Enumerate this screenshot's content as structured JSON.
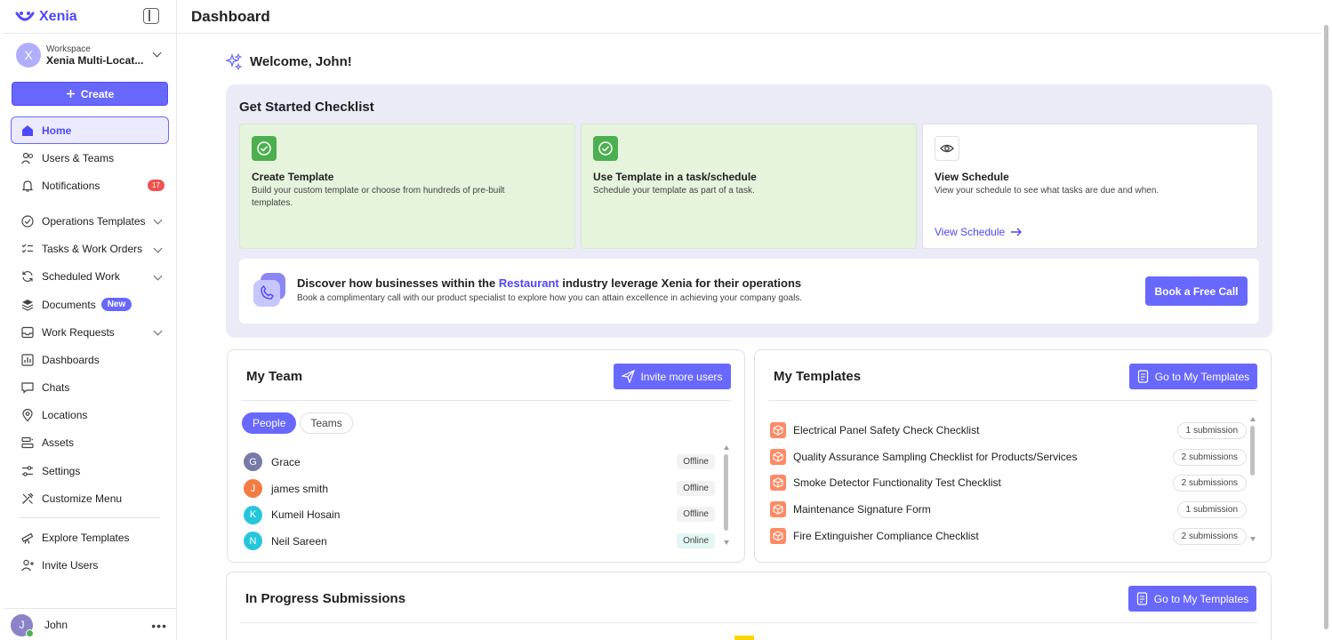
{
  "brand": {
    "name": "Xenia",
    "color": "#4E48FA"
  },
  "workspace": {
    "label": "Workspace",
    "name": "Xenia Multi-Locat...",
    "avatar_letter": "X"
  },
  "create_label": "Create",
  "nav": [
    {
      "label": "Home",
      "icon": "home-icon",
      "active": true
    },
    {
      "label": "Users & Teams",
      "icon": "users-icon"
    },
    {
      "label": "Notifications",
      "icon": "bell-icon",
      "badge": "17"
    },
    {
      "label": "Operations Templates",
      "icon": "check-circle-icon",
      "chevron": true
    },
    {
      "label": "Tasks & Work Orders",
      "icon": "tasks-icon",
      "chevron": true
    },
    {
      "label": "Scheduled Work",
      "icon": "refresh-icon",
      "chevron": true
    },
    {
      "label": "Documents",
      "icon": "layers-icon",
      "badge_new": "New"
    },
    {
      "label": "Work Requests",
      "icon": "inbox-icon",
      "chevron": true
    },
    {
      "label": "Dashboards",
      "icon": "dashboard-icon"
    },
    {
      "label": "Chats",
      "icon": "chat-icon"
    },
    {
      "label": "Locations",
      "icon": "pin-icon"
    },
    {
      "label": "Assets",
      "icon": "assets-icon"
    },
    {
      "label": "Settings",
      "icon": "settings-icon"
    },
    {
      "label": "Customize Menu",
      "icon": "customize-icon"
    }
  ],
  "nav_bottom": [
    {
      "label": "Explore Templates",
      "icon": "telescope-icon"
    },
    {
      "label": "Invite Users",
      "icon": "invite-icon"
    }
  ],
  "user": {
    "name": "John",
    "avatar_letter": "J"
  },
  "page_title": "Dashboard",
  "welcome": "Welcome, John!",
  "get_started": {
    "title": "Get Started Checklist",
    "cards": [
      {
        "title": "Create Template",
        "desc": "Build your custom template or choose from hundreds of pre-built templates."
      },
      {
        "title": "Use Template in a task/schedule",
        "desc": "Schedule your template as part of a task."
      },
      {
        "title": "View Schedule",
        "desc": "View your schedule to see what tasks are due and when.",
        "link": "View Schedule"
      }
    ],
    "discover": {
      "title_pre": "Discover how businesses within the ",
      "industry": "Restaurant",
      "title_post": " industry leverage Xenia for their operations",
      "desc": "Book a complimentary call with our product specialist to explore how you can attain excellence in achieving your company goals.",
      "button": "Book a Free Call"
    }
  },
  "my_team": {
    "title": "My Team",
    "invite_button": "Invite more users",
    "tabs": [
      "People",
      "Teams"
    ],
    "people": [
      {
        "letter": "G",
        "name": "Grace",
        "status": "Offline",
        "color": "#7A7AA8"
      },
      {
        "letter": "J",
        "name": "james smith",
        "status": "Offline",
        "color": "#F47B42"
      },
      {
        "letter": "K",
        "name": "Kumeil Hosain",
        "status": "Offline",
        "color": "#26C6DA"
      },
      {
        "letter": "N",
        "name": "Neil Sareen",
        "status": "Online",
        "color": "#26C6DA"
      }
    ]
  },
  "my_templates": {
    "title": "My Templates",
    "button": "Go to My Templates",
    "items": [
      {
        "name": "Electrical Panel Safety Check Checklist",
        "count": "1 submission"
      },
      {
        "name": "Quality Assurance Sampling Checklist for Products/Services",
        "count": "2 submissions"
      },
      {
        "name": "Smoke Detector Functionality Test Checklist",
        "count": "2 submissions"
      },
      {
        "name": "Maintenance Signature Form",
        "count": "1 submission"
      },
      {
        "name": "Fire Extinguisher Compliance Checklist",
        "count": "2 submissions"
      }
    ]
  },
  "in_progress": {
    "title": "In Progress Submissions",
    "button": "Go to My Templates"
  }
}
